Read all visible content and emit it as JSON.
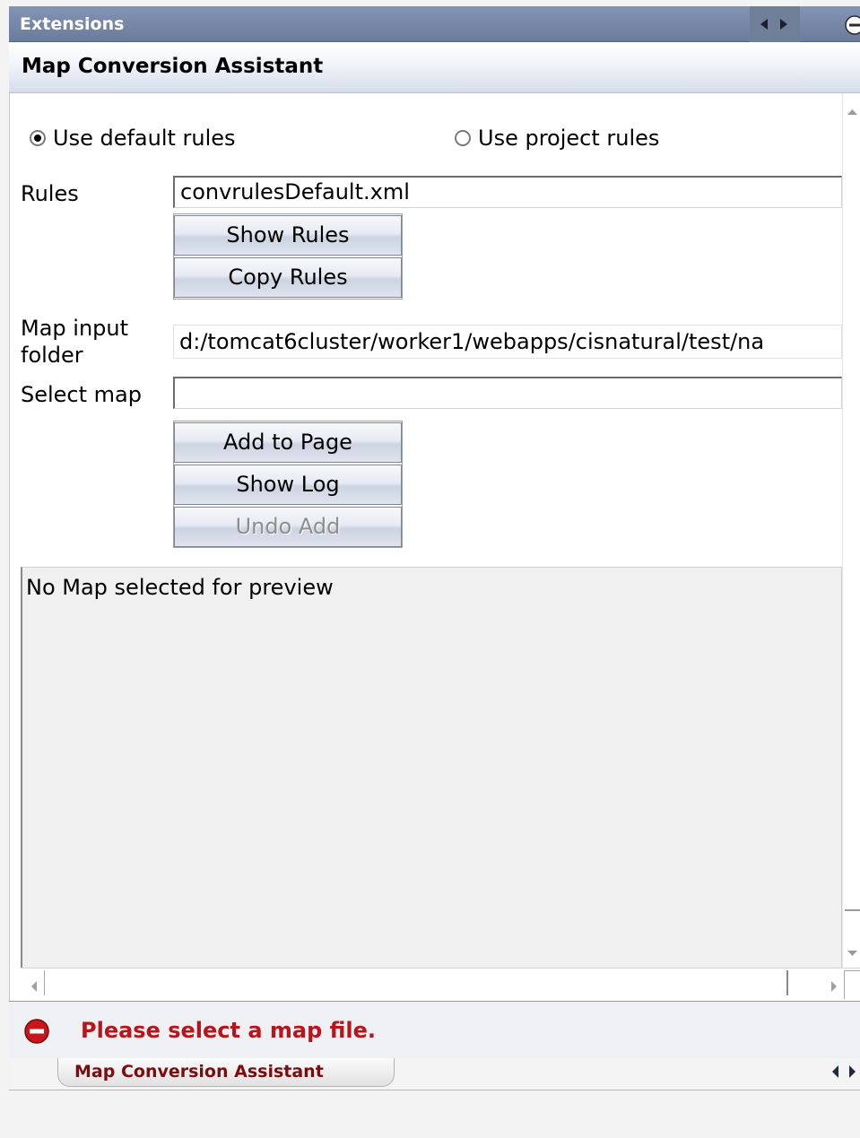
{
  "header": {
    "title": "Extensions"
  },
  "panel": {
    "title": "Map Conversion Assistant"
  },
  "rules_mode": {
    "options": [
      {
        "label": "Use default rules",
        "selected": true
      },
      {
        "label": "Use project rules",
        "selected": false
      }
    ]
  },
  "rules": {
    "label": "Rules",
    "value": "convrulesDefault.xml"
  },
  "buttons": {
    "show_rules": "Show Rules",
    "copy_rules": "Copy Rules",
    "add_to_page": "Add to Page",
    "show_log": "Show Log",
    "undo_add": "Undo Add"
  },
  "map_input_folder": {
    "label_line1": "Map input",
    "label_line2": "folder",
    "value": "d:/tomcat6cluster/worker1/webapps/cisnatural/test/na"
  },
  "select_map": {
    "label": "Select map",
    "value": ""
  },
  "preview": {
    "text": "No Map selected for preview"
  },
  "status": {
    "message": "Please select a map file.",
    "type": "error",
    "color": "#b5161c"
  },
  "tabs": [
    {
      "label": "Map Conversion Assistant",
      "active": true
    }
  ],
  "colors": {
    "header": "#7585a6",
    "accent_error": "#b5161c"
  }
}
